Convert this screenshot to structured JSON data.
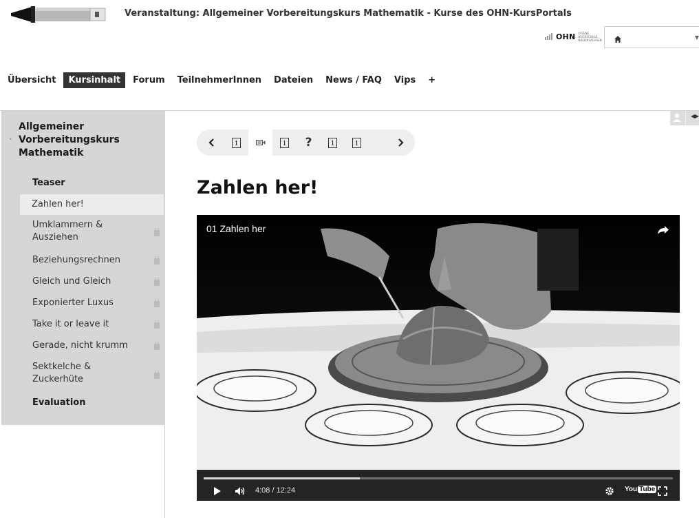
{
  "header": {
    "title": "Veranstaltung: Allgemeiner Vorbereitungskurs Mathematik - Kurse des OHN-KursPortals",
    "ohn_logo_text": "OHN",
    "ohn_logo_small": "OFFENE HOCHSCHULE NIEDERSACHSEN"
  },
  "nav": {
    "items": [
      {
        "label": "Übersicht",
        "active": false
      },
      {
        "label": "Kursinhalt",
        "active": true
      },
      {
        "label": "Forum",
        "active": false
      },
      {
        "label": "TeilnehmerInnen",
        "active": false
      },
      {
        "label": "Dateien",
        "active": false
      },
      {
        "label": "News / FAQ",
        "active": false
      },
      {
        "label": "Vips",
        "active": false
      },
      {
        "label": "+",
        "active": false
      }
    ]
  },
  "sidebar": {
    "course_title": "Allgemeiner Vorbereitungskurs Mathematik",
    "items": [
      {
        "label": "Teaser",
        "bold": true,
        "locked": false,
        "selected": false
      },
      {
        "label": "Zahlen her!",
        "bold": false,
        "locked": false,
        "selected": true
      },
      {
        "label": "Umklammern & Ausziehen",
        "bold": false,
        "locked": true,
        "selected": false
      },
      {
        "label": "Beziehungsrechnen",
        "bold": false,
        "locked": true,
        "selected": false
      },
      {
        "label": "Gleich und Gleich",
        "bold": false,
        "locked": true,
        "selected": false
      },
      {
        "label": "Exponierter Luxus",
        "bold": false,
        "locked": true,
        "selected": false
      },
      {
        "label": "Take it or leave it",
        "bold": false,
        "locked": true,
        "selected": false
      },
      {
        "label": "Gerade, nicht krumm",
        "bold": false,
        "locked": true,
        "selected": false
      },
      {
        "label": "Sektkelche & Zuckerhüte",
        "bold": false,
        "locked": true,
        "selected": false
      },
      {
        "label": "Evaluation",
        "bold": true,
        "locked": false,
        "selected": false
      }
    ]
  },
  "stepper": {
    "steps": [
      "prev",
      "info",
      "video",
      "info",
      "quiz",
      "info",
      "info",
      "next"
    ],
    "current_index": 2,
    "info_glyph": "i",
    "quiz_glyph": "?"
  },
  "content": {
    "heading": "Zahlen her!"
  },
  "video": {
    "title": "01 Zahlen her",
    "time": "4:08 / 12:24",
    "progress": 0.333,
    "youtube_you": "You",
    "youtube_tube": "Tube"
  }
}
